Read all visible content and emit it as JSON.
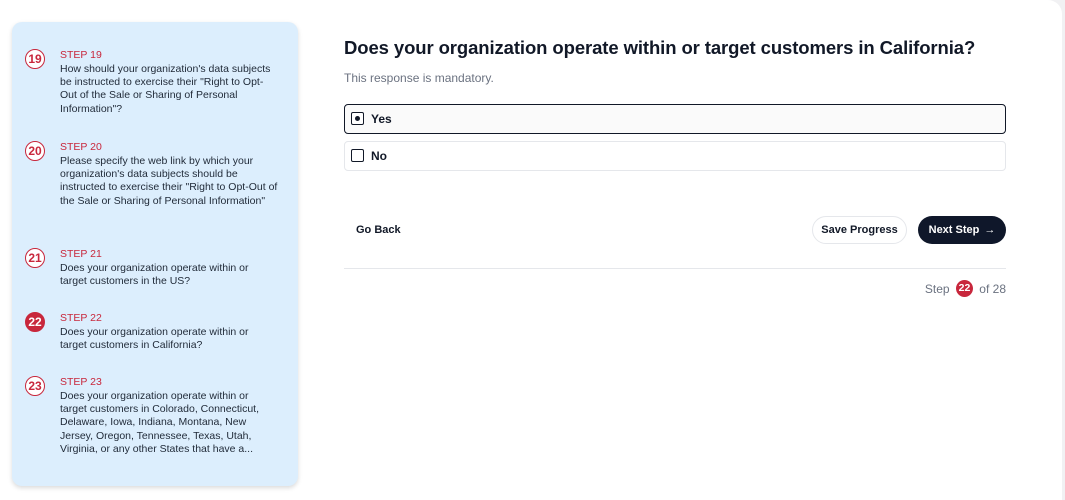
{
  "sidebar": {
    "steps": [
      {
        "number": "19",
        "title": "STEP 19",
        "text": "How should your organization's data subjects be instructed to exercise their \"Right to Opt-Out of the Sale or Sharing of Personal Information\"?",
        "active": false
      },
      {
        "number": "20",
        "title": "STEP 20",
        "text": "Please specify the web link by which your organization's data subjects should be instructed to exercise their \"Right to Opt-Out of the Sale or Sharing of Personal Information\"",
        "active": false
      },
      {
        "number": "21",
        "title": "STEP 21",
        "text": "Does your organization operate within or target customers in the US?",
        "active": false
      },
      {
        "number": "22",
        "title": "STEP 22",
        "text": "Does your organization operate within or target customers in California?",
        "active": true
      },
      {
        "number": "23",
        "title": "STEP 23",
        "text": "Does your organization operate within or target customers in Colorado, Connecticut, Delaware, Iowa, Indiana, Montana, New Jersey, Oregon, Tennessee, Texas, Utah, Virginia, or any other States that have a...",
        "active": false
      }
    ]
  },
  "question": {
    "title": "Does your organization operate within or target customers in California?",
    "note": "This response is mandatory.",
    "options": [
      {
        "label": "Yes",
        "selected": true
      },
      {
        "label": "No",
        "selected": false
      }
    ]
  },
  "actions": {
    "back_label": "Go Back",
    "save_label": "Save Progress",
    "next_label": "Next Step",
    "next_icon": "arrow-right-icon"
  },
  "progress": {
    "prefix": "Step",
    "current": "22",
    "suffix": "of 28"
  },
  "colors": {
    "accent": "#c8273c",
    "sidebar_bg": "#dceefd",
    "primary_button": "#0f172a"
  }
}
